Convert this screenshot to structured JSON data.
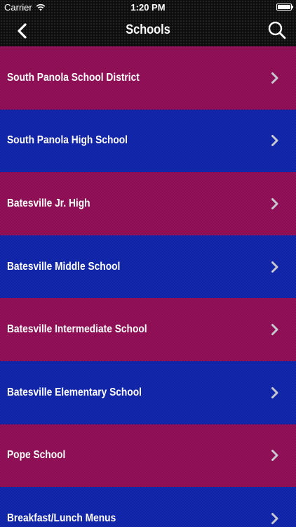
{
  "status_bar": {
    "carrier": "Carrier",
    "time": "1:20 PM",
    "battery_level": 1.0
  },
  "nav": {
    "title": "Schools",
    "back_icon": "chevron-left-icon",
    "search_icon": "search-icon"
  },
  "colors": {
    "maroon": "#8c0b52",
    "blue": "#0d22a6",
    "nav_background": "#0e0e0e",
    "text": "#ffffff",
    "chevron": "#c8c8d0"
  },
  "schools": [
    {
      "label": "South Panola School District",
      "color": "maroon"
    },
    {
      "label": "South Panola High School",
      "color": "blue"
    },
    {
      "label": "Batesville Jr. High",
      "color": "maroon"
    },
    {
      "label": "Batesville Middle School",
      "color": "blue"
    },
    {
      "label": "Batesville Intermediate School",
      "color": "maroon"
    },
    {
      "label": "Batesville Elementary School",
      "color": "blue"
    },
    {
      "label": "Pope School",
      "color": "maroon"
    },
    {
      "label": "Breakfast/Lunch Menus",
      "color": "blue"
    }
  ]
}
